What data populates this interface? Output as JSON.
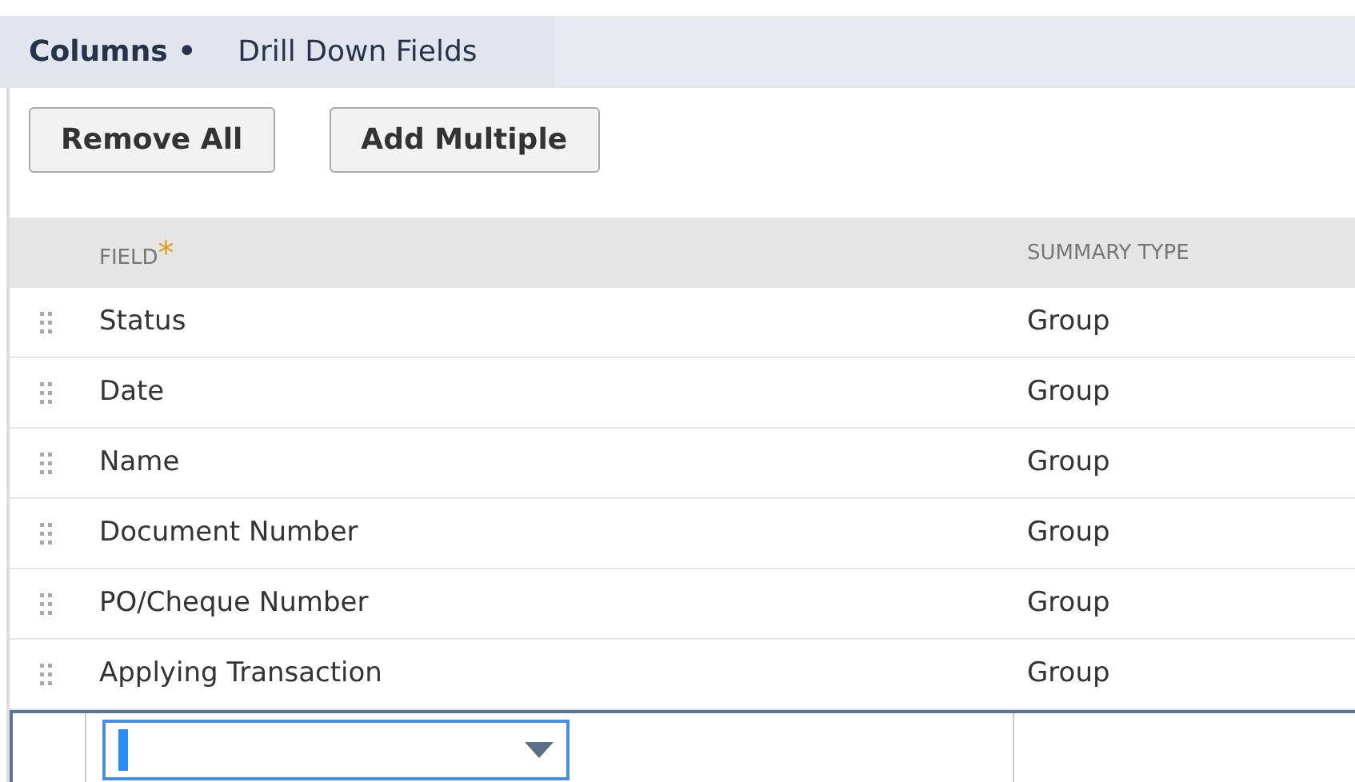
{
  "tabs": [
    {
      "label": "Columns •",
      "selected": true
    },
    {
      "label": "Drill Down Fields",
      "selected": false
    }
  ],
  "buttons": [
    "Remove All",
    "Add Multiple"
  ],
  "table": {
    "columns": [
      {
        "label": "FIELD",
        "required": true,
        "required_mark": "*"
      },
      {
        "label": "SUMMARY TYPE",
        "required": false
      }
    ],
    "rows": [
      {
        "field": "Status",
        "summary_type": "Group"
      },
      {
        "field": "Date",
        "summary_type": "Group"
      },
      {
        "field": "Name",
        "summary_type": "Group"
      },
      {
        "field": "Document Number",
        "summary_type": "Group"
      },
      {
        "field": "PO/Cheque Number",
        "summary_type": "Group"
      },
      {
        "field": "Applying Transaction",
        "summary_type": "Group"
      }
    ],
    "edit_row": {
      "editing": true
    }
  }
}
